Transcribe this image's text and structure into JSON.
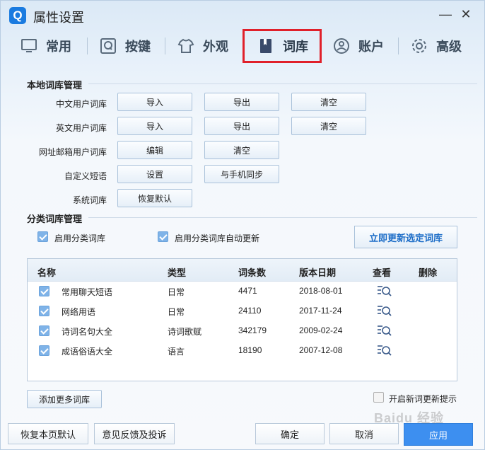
{
  "window": {
    "title": "属性设置",
    "logo": "Q",
    "minimize_glyph": "—",
    "close_glyph": "✕"
  },
  "tabs": [
    {
      "label": "常用",
      "icon": "monitor-icon"
    },
    {
      "label": "按键",
      "icon": "keyboard-key-icon"
    },
    {
      "label": "外观",
      "icon": "tshirt-icon"
    },
    {
      "label": "词库",
      "icon": "book-icon",
      "active": true
    },
    {
      "label": "账户",
      "icon": "user-icon"
    },
    {
      "label": "高级",
      "icon": "gear-icon"
    }
  ],
  "local": {
    "title": "本地词库管理",
    "rows": [
      {
        "label": "中文用户词库",
        "buttons": [
          "导入",
          "导出",
          "清空"
        ]
      },
      {
        "label": "英文用户词库",
        "buttons": [
          "导入",
          "导出",
          "清空"
        ]
      },
      {
        "label": "网址邮箱用户词库",
        "buttons": [
          "编辑",
          "清空"
        ]
      },
      {
        "label": "自定义短语",
        "buttons": [
          "设置",
          "与手机同步"
        ]
      },
      {
        "label": "系统词库",
        "buttons": [
          "恢复默认"
        ]
      }
    ]
  },
  "category": {
    "title": "分类词库管理",
    "enable_label": "启用分类词库",
    "auto_update_label": "启用分类词库自动更新",
    "update_button": "立即更新选定词库"
  },
  "table": {
    "headers": {
      "name": "名称",
      "type": "类型",
      "count": "词条数",
      "date": "版本日期",
      "view": "查看",
      "delete": "删除"
    },
    "rows": [
      {
        "name": "常用聊天短语",
        "type": "日常",
        "count": "4471",
        "date": "2018-08-01",
        "checked": true
      },
      {
        "name": "网络用语",
        "type": "日常",
        "count": "24110",
        "date": "2017-11-24",
        "checked": true
      },
      {
        "name": "诗词名句大全",
        "type": "诗词歌赋",
        "count": "342179",
        "date": "2009-02-24",
        "checked": true
      },
      {
        "name": "成语俗语大全",
        "type": "语言",
        "count": "18190",
        "date": "2007-12-08",
        "checked": true
      }
    ]
  },
  "add_more": "添加更多词库",
  "new_word_hint": "开启新词更新提示",
  "footer": {
    "restore": "恢复本页默认",
    "feedback": "意见反馈及投诉",
    "ok": "确定",
    "cancel": "取消",
    "apply": "应用"
  },
  "watermark": "Baidu 经验",
  "colors": {
    "accent": "#1a7be0",
    "active_tab_border": "#e0202a",
    "apply_bg": "#3d8ff0"
  }
}
